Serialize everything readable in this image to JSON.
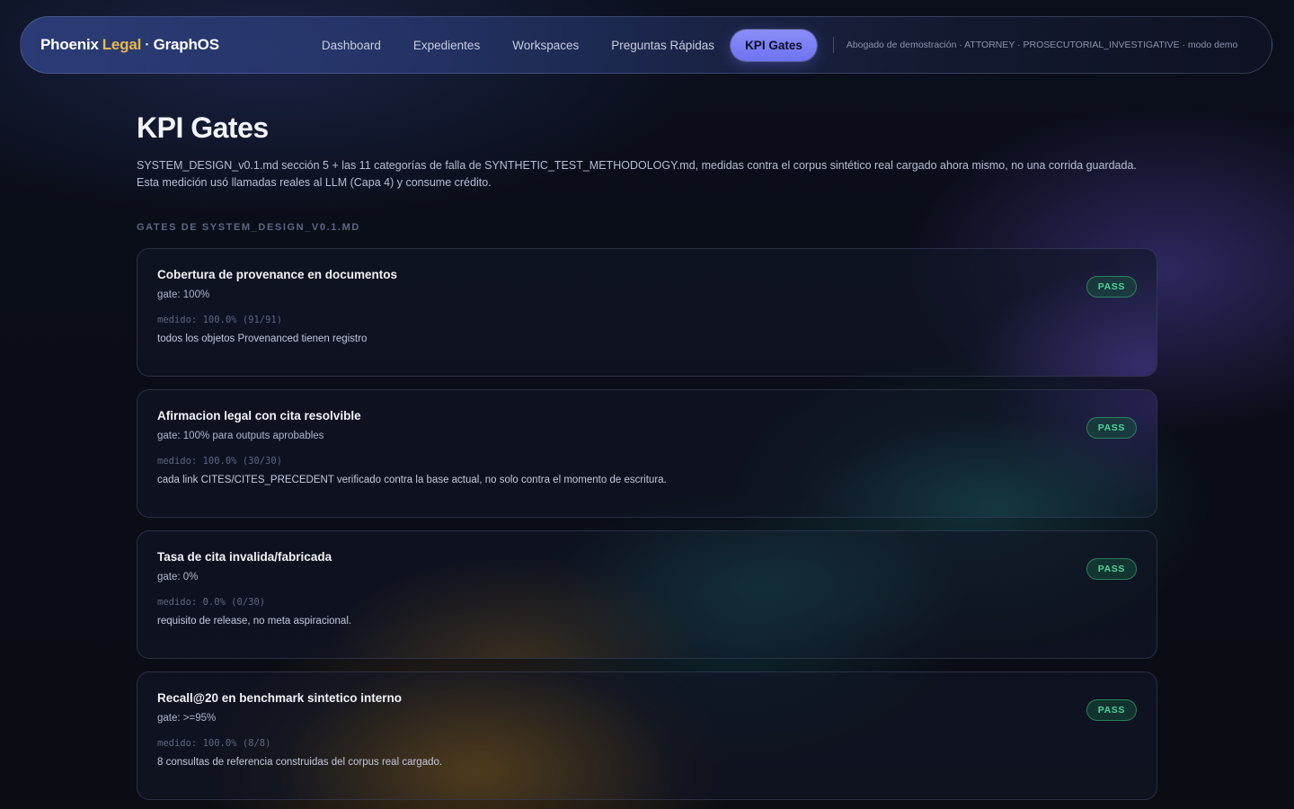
{
  "brand": {
    "part1": "Phoenix",
    "part2": "Legal",
    "separator": "·",
    "part3": "GraphOS"
  },
  "nav": {
    "items": [
      {
        "label": "Dashboard",
        "active": false
      },
      {
        "label": "Expedientes",
        "active": false
      },
      {
        "label": "Workspaces",
        "active": false
      },
      {
        "label": "Preguntas Rápidas",
        "active": false
      },
      {
        "label": "KPI Gates",
        "active": true
      }
    ],
    "user_info": "Abogado de demostración · ATTORNEY · PROSECUTORIAL_INVESTIGATIVE · modo demo"
  },
  "page": {
    "title": "KPI Gates",
    "description": "SYSTEM_DESIGN_v0.1.md sección 5 + las 11 categorías de falla de SYNTHETIC_TEST_METHODOLOGY.md, medidas contra el corpus sintético real cargado ahora mismo, no una corrida guardada. Esta medición usó llamadas reales al LLM (Capa 4) y consume crédito.",
    "section_label": "Gates de SYSTEM_DESIGN_v0.1.md"
  },
  "gates": [
    {
      "title": "Cobertura de provenance en documentos",
      "threshold": "gate: 100%",
      "measured": "medido: 100.0% (91/91)",
      "note": "todos los objetos Provenanced tienen registro",
      "status": "PASS"
    },
    {
      "title": "Afirmacion legal con cita resolvible",
      "threshold": "gate: 100% para outputs aprobables",
      "measured": "medido: 100.0% (30/30)",
      "note": "cada link CITES/CITES_PRECEDENT verificado contra la base actual, no solo contra el momento de escritura.",
      "status": "PASS"
    },
    {
      "title": "Tasa de cita invalida/fabricada",
      "threshold": "gate: 0%",
      "measured": "medido: 0.0% (0/30)",
      "note": "requisito de release, no meta aspiracional.",
      "status": "PASS"
    },
    {
      "title": "Recall@20 en benchmark sintetico interno",
      "threshold": "gate: >=95%",
      "measured": "medido: 100.0% (8/8)",
      "note": "8 consultas de referencia construidas del corpus real cargado.",
      "status": "PASS"
    }
  ],
  "colors": {
    "accent": "#7d80f5",
    "brand_gold": "#e9b84a",
    "pass_green": "#4fd39a"
  }
}
